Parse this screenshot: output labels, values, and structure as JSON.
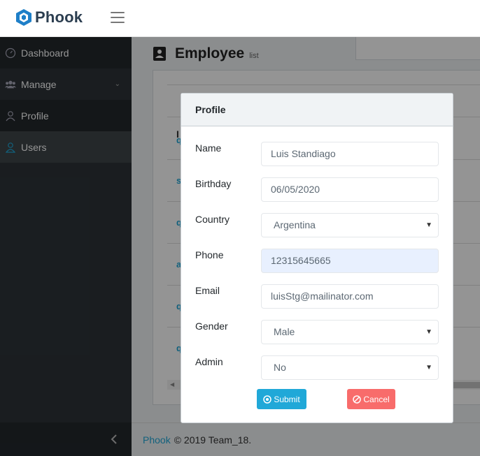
{
  "brand": {
    "name": "Phook",
    "accent": "#1e7fc8"
  },
  "sidebar": {
    "items": [
      {
        "label": "Dashboard",
        "icon": "speedometer-icon"
      },
      {
        "label": "Manage",
        "icon": "people-icon",
        "has_submenu": true
      },
      {
        "label": "Profile",
        "icon": "user-icon"
      },
      {
        "label": "Users",
        "icon": "user-outline-icon",
        "active": true
      }
    ]
  },
  "page": {
    "title": "Employee",
    "subtitle": "list",
    "table_header_fragment": "I",
    "row_fragments": [
      "q",
      "s",
      "q",
      "a",
      "q",
      "q"
    ]
  },
  "modal": {
    "title": "Profile",
    "fields": [
      {
        "label": "Name",
        "value": "Luis Standiago",
        "type": "text"
      },
      {
        "label": "Birthday",
        "value": "06/05/2020",
        "type": "date"
      },
      {
        "label": "Country",
        "value": "Argentina",
        "type": "select"
      },
      {
        "label": "Phone",
        "value": "12315645665",
        "type": "text",
        "autofilled": true
      },
      {
        "label": "Email",
        "value": "luisStg@mailinator.com",
        "type": "text"
      },
      {
        "label": "Gender",
        "value": "Male",
        "type": "select"
      },
      {
        "label": "Admin",
        "value": "No",
        "type": "select"
      }
    ],
    "submit_label": "Submit",
    "cancel_label": "Cancel"
  },
  "footer": {
    "link": "Phook",
    "text": "© 2019 Team_18."
  },
  "colors": {
    "primary": "#20a8d8",
    "danger": "#f86c6b",
    "sidebar": "#2d3338"
  }
}
